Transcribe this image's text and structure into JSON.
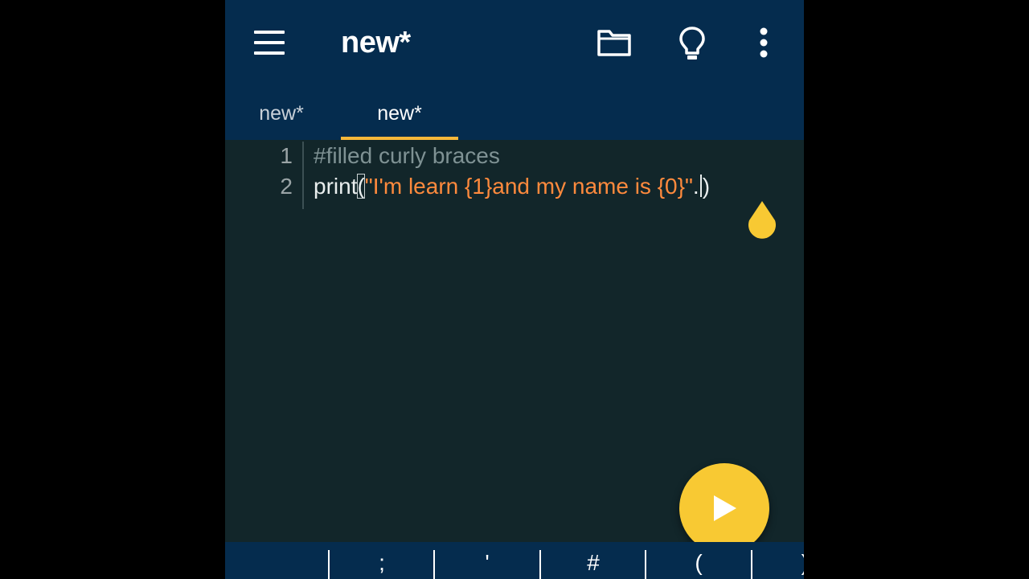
{
  "appbar": {
    "title": "new*",
    "icons": [
      "menu-icon",
      "folder-icon",
      "lightbulb-icon",
      "more-vert-icon"
    ]
  },
  "tabs": [
    {
      "label": "new*",
      "active": false
    },
    {
      "label": "new*",
      "active": true
    }
  ],
  "editor": {
    "line_numbers": [
      "1",
      "2"
    ],
    "line1": "#filled curly braces",
    "line2": {
      "func": "print",
      "open_paren": "(",
      "string": "\"I'm learn {1}and my name is {0}\"",
      "dot": ".",
      "close_paren": ")"
    }
  },
  "keybar": {
    "keys": [
      ";",
      "'",
      "#",
      "(",
      ")"
    ]
  },
  "colors": {
    "appbar": "#052c4e",
    "editor_bg": "#12262a",
    "accent": "#f7b83a",
    "string": "#ff8a3d",
    "comment": "#7f9294",
    "run_button": "#f8c933"
  }
}
